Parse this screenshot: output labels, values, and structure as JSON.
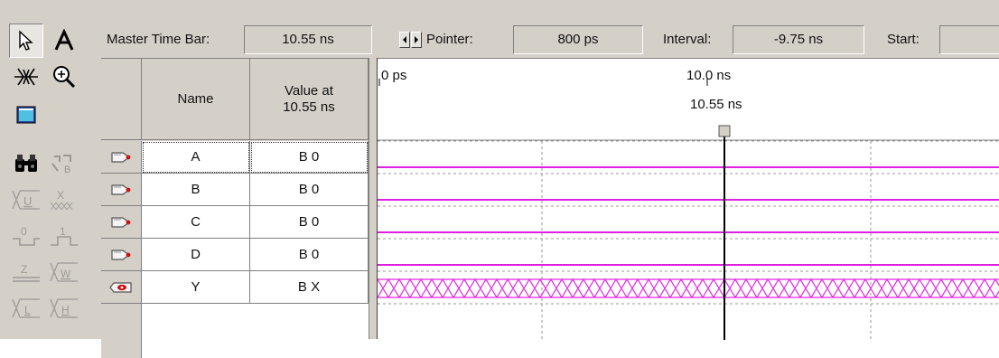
{
  "toolbar": {
    "tools": [
      {
        "name": "selection-tool",
        "icon": "pointer-arrow-icon"
      },
      {
        "name": "text-tool",
        "icon": "text-A-icon"
      },
      {
        "name": "waveform-editing-tool",
        "icon": "waveform-edit-icon"
      },
      {
        "name": "zoom-tool",
        "icon": "magnifier-icon"
      },
      {
        "name": "full-screen-tool",
        "icon": "full-screen-icon"
      },
      {
        "name": "find-tool",
        "icon": "binoculars-icon"
      },
      {
        "name": "replace-tool",
        "icon": "replace-icon"
      },
      {
        "name": "uninitialized-tool",
        "icon": "uninitialized-U-icon"
      },
      {
        "name": "dont-care-tool",
        "icon": "dont-care-X-icon"
      },
      {
        "name": "forcing-low-tool",
        "icon": "force-low-0-icon"
      },
      {
        "name": "forcing-high-tool",
        "icon": "force-high-1-icon"
      },
      {
        "name": "high-impedance-tool",
        "icon": "high-impedance-Z-icon"
      },
      {
        "name": "weak-unknown-tool",
        "icon": "weak-unknown-W-icon"
      },
      {
        "name": "weak-low-tool",
        "icon": "weak-low-L-icon"
      },
      {
        "name": "weak-high-tool",
        "icon": "weak-high-H-icon"
      }
    ]
  },
  "timebar": {
    "master_label": "Master Time Bar:",
    "master_value": "10.55 ns",
    "pointer_label": "Pointer:",
    "pointer_value": "800 ps",
    "interval_label": "Interval:",
    "interval_value": "-9.75 ns",
    "start_label": "Start:",
    "start_value": ""
  },
  "table": {
    "columns": {
      "name": "Name",
      "value": "Value at\n10.55 ns"
    },
    "rows": [
      {
        "name": "A",
        "value": "B 0",
        "kind": "input",
        "icon": "input-pin-icon"
      },
      {
        "name": "B",
        "value": "B 0",
        "kind": "input",
        "icon": "input-pin-icon"
      },
      {
        "name": "C",
        "value": "B 0",
        "kind": "input",
        "icon": "input-pin-icon"
      },
      {
        "name": "D",
        "value": "B 0",
        "kind": "input",
        "icon": "input-pin-icon"
      },
      {
        "name": "Y",
        "value": "B X",
        "kind": "output",
        "icon": "output-pin-icon"
      }
    ]
  },
  "waveform": {
    "time_start_label": "0 ps",
    "time_mark_label": "10.0 ns",
    "master_marker_label": "10.55 ns",
    "signal_color": "#e020e0",
    "grid_color": "#9a9a9a",
    "signals": [
      {
        "name": "A",
        "level": "low"
      },
      {
        "name": "B",
        "level": "low"
      },
      {
        "name": "C",
        "level": "low"
      },
      {
        "name": "D",
        "level": "low"
      },
      {
        "name": "Y",
        "level": "unknown"
      }
    ]
  }
}
